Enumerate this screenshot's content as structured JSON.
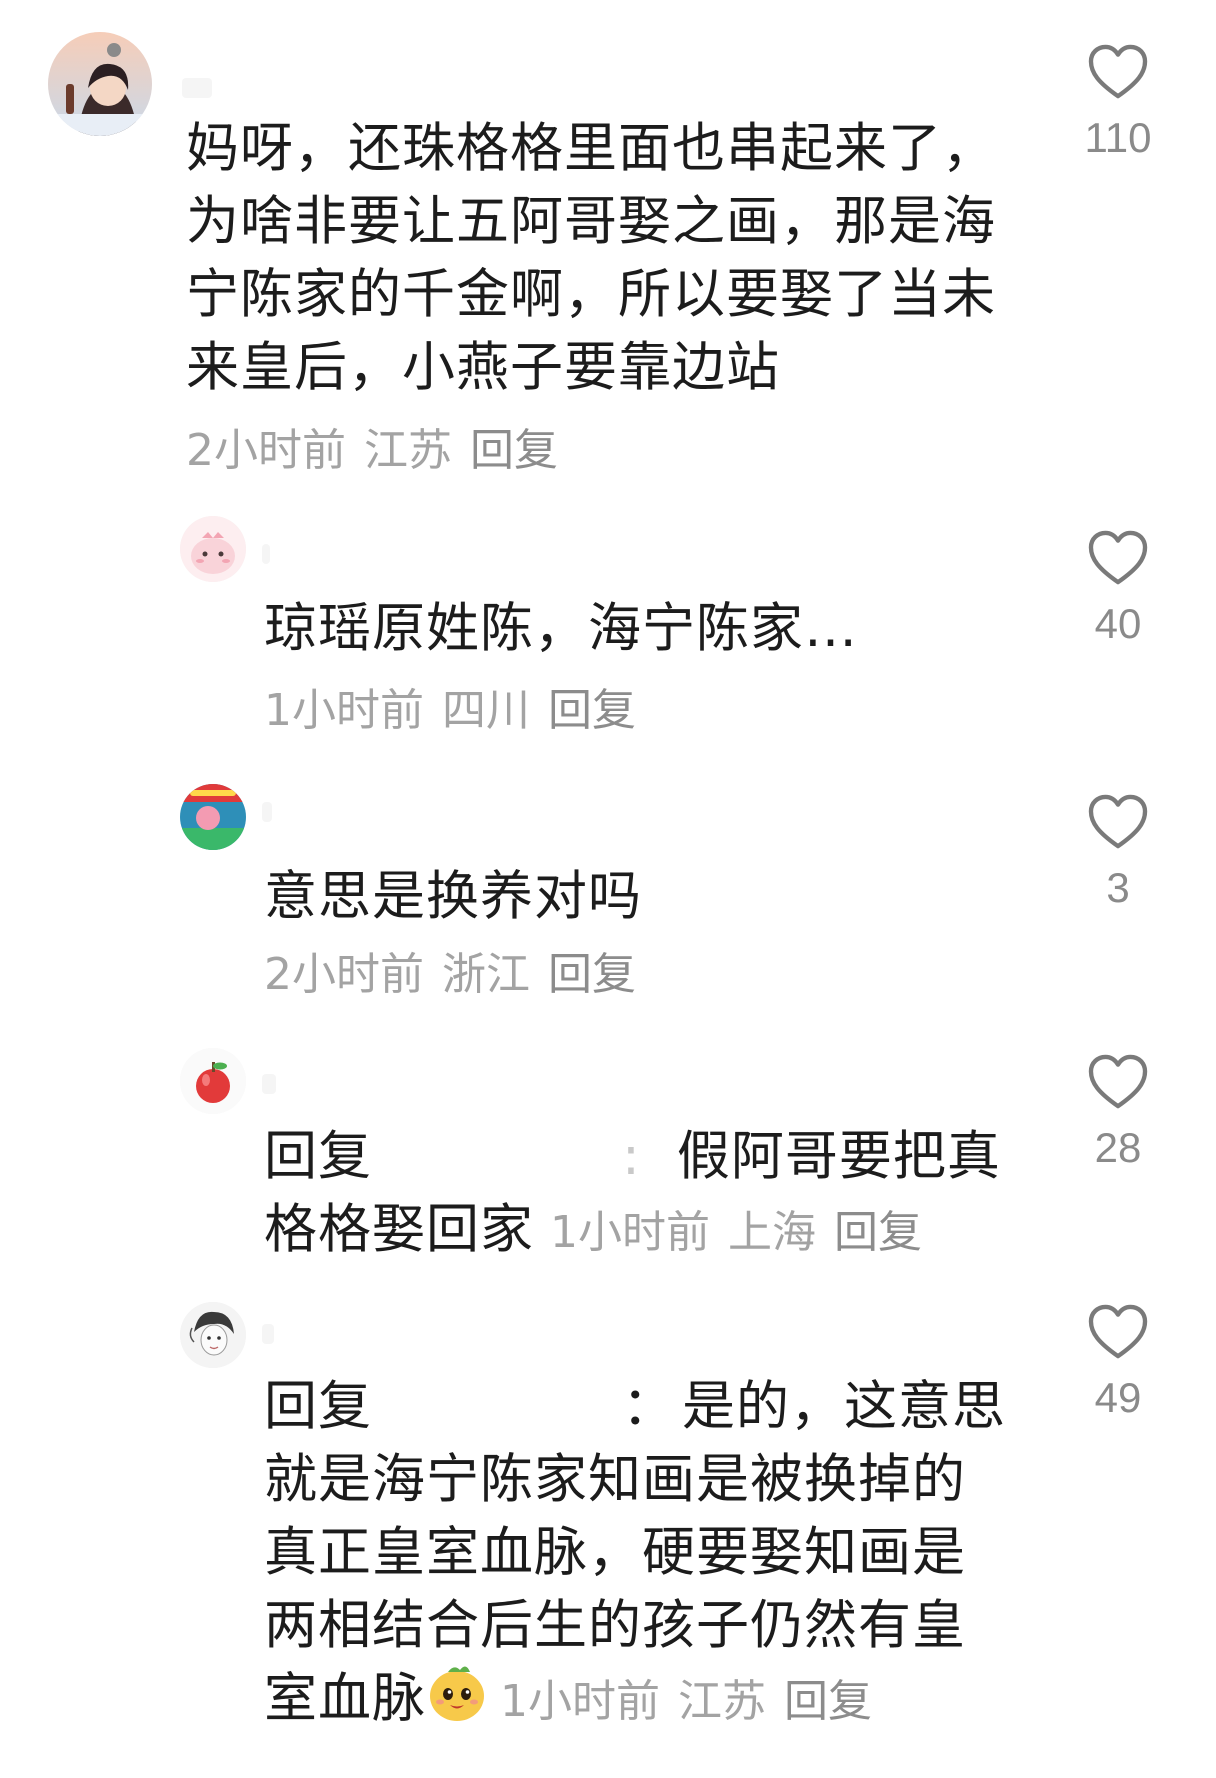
{
  "comments": [
    {
      "lines": [
        "妈呀，还珠格格里面也串起来了，",
        "为啥非要让五阿哥娶之画，那是海",
        "宁陈家的千金啊，所以要娶了当未",
        "来皇后，小燕子要靠边站"
      ],
      "time": "2小时前",
      "location": "江苏",
      "reply": "回复",
      "likes": "110"
    },
    {
      "lines": [
        "琼瑶原姓陈，海宁陈家…"
      ],
      "time": "1小时前",
      "location": "四川",
      "reply": "回复",
      "likes": "40"
    },
    {
      "lines": [
        "意思是换养对吗"
      ],
      "time": "2小时前",
      "location": "浙江",
      "reply": "回复",
      "likes": "3"
    },
    {
      "reply_prefix": "回复",
      "reply_colon": ":",
      "lines": [
        "假阿哥要把真",
        "格格娶回家"
      ],
      "time": "1小时前",
      "location": "上海",
      "reply": "回复",
      "likes": "28"
    },
    {
      "reply_prefix": "回复",
      "reply_colon": "：",
      "lines": [
        "是的，这意思",
        "就是海宁陈家知画是被换掉的",
        "真正皇室血脉，硬要娶知画是",
        "两相结合后生的孩子仍然有皇",
        "室血脉"
      ],
      "time": "1小时前",
      "location": "江苏",
      "reply": "回复",
      "likes": "49"
    }
  ],
  "icons": {
    "like": "heart-outline-icon",
    "emoji": "smiling-face-emoji"
  },
  "colors": {
    "text": "#1c1c1c",
    "meta": "#a3a3a3",
    "heart": "#7a7a7a"
  }
}
